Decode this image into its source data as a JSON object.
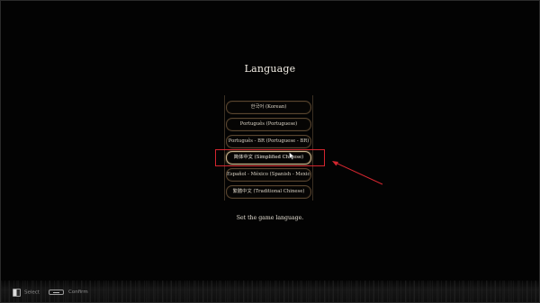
{
  "screen": {
    "title": "Language",
    "description": "Set the game language.",
    "languages": [
      {
        "label": "한국어 (Korean)",
        "selected": false
      },
      {
        "label": "Português (Portuguese)",
        "selected": false
      },
      {
        "label": "Português - BR (Portuguese - BR)",
        "selected": false
      },
      {
        "label": "简体中文 (Simplified Chinese)",
        "selected": true
      },
      {
        "label": "Español - México (Spanish - Mexico)",
        "selected": false
      },
      {
        "label": "繁體中文 (Traditional Chinese)",
        "selected": false
      }
    ]
  },
  "hints": {
    "select_label": "Select",
    "confirm_label": "Confirm"
  },
  "annotation": {
    "highlight_color": "#d3262f"
  }
}
